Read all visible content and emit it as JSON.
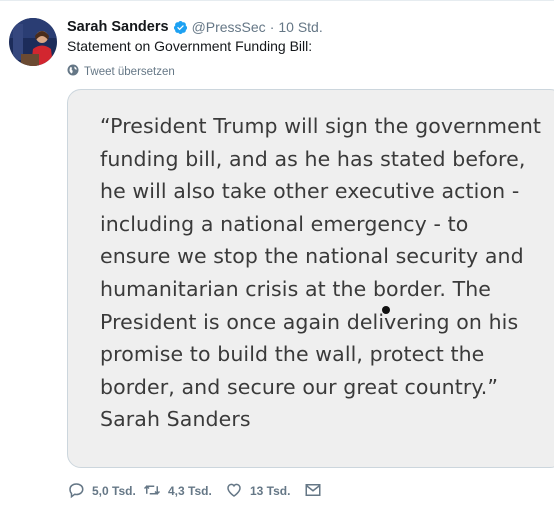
{
  "tweet": {
    "author_name": "Sarah Sanders",
    "handle": "@PressSec",
    "separator": "·",
    "time": "10 Std.",
    "text": "Statement on Government Funding Bill:",
    "translate_label": "Tweet übersetzen",
    "verified_icon": "verified-badge-icon",
    "verified_color": "#1da1f2"
  },
  "media": {
    "lines": [
      "“President Trump will sign the government",
      "funding bill, and as he has stated before,",
      "he will also take other executive action -",
      "including a national emergency - to",
      "ensure we stop the national security and",
      "humanitarian crisis at the border. The",
      "President is once again delivering on his",
      "promise to build the wall, protect the",
      "border, and secure our great country.”",
      "Sarah Sanders"
    ],
    "background": "#efefef",
    "text_color": "#3a3a3a"
  },
  "actions": {
    "replies": "5,0 Tsd.",
    "retweets": "4,3 Tsd.",
    "likes": "13 Tsd.",
    "reply_icon": "reply-icon",
    "retweet_icon": "retweet-icon",
    "like_icon": "heart-icon",
    "dm_icon": "envelope-icon"
  }
}
